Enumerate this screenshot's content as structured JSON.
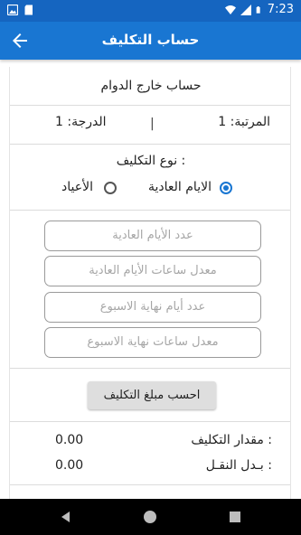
{
  "status_bar": {
    "time": "7:23"
  },
  "app_bar": {
    "title": "حساب التكليف"
  },
  "form": {
    "heading": "حساب خارج الدوام",
    "rank_label": "المرتبة: 1",
    "separator": "|",
    "grade_label": "الدرجة: 1",
    "assignment_type_label": "نوع التكليف :",
    "options": [
      {
        "label": "الايام العادية",
        "selected": true
      },
      {
        "label": "الأعياد",
        "selected": false
      }
    ],
    "fields": [
      {
        "placeholder": "عدد الأيام العادية"
      },
      {
        "placeholder": "معدل ساعات الأيام العادية"
      },
      {
        "placeholder": "عدد أيام نهاية الاسبوع"
      },
      {
        "placeholder": "معدل ساعات نهاية الاسبوع"
      }
    ],
    "calculate_button": "احسب مبلغ التكليف"
  },
  "results": {
    "amount_label": "مقدار التكليف :",
    "amount_value": "0.00",
    "transport_label": "بـدل النقـل :",
    "transport_value": "0.00"
  },
  "colors": {
    "status_bar": "#1565C0",
    "app_bar": "#1976D2",
    "accent": "#1976D2"
  }
}
